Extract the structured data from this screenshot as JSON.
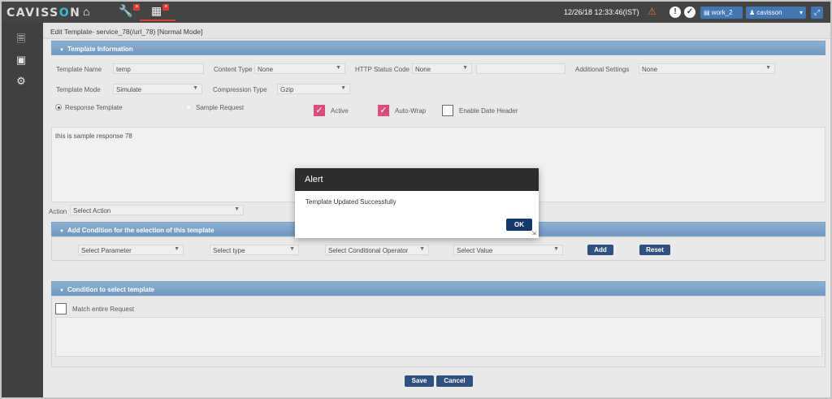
{
  "app": {
    "logo_main": "CAVISS",
    "logo_o": "O",
    "logo_end": "N",
    "datetime": "12/26/18 12:33:46(IST)",
    "workspace_btn": "work_2",
    "user_btn": "cavisson"
  },
  "page": {
    "title": "Edit Template- service_78(/url_78) [Normal Mode]"
  },
  "template_info": {
    "section_title": "Template Information",
    "template_name_label": "Template Name",
    "template_name_value": "temp",
    "content_type_label": "Content Type",
    "content_type_value": "None",
    "http_status_label": "HTTP Status Code",
    "http_status_value": "None",
    "additional_settings_label": "Additional Settings",
    "additional_settings_value": "None",
    "template_mode_label": "Template Mode",
    "template_mode_value": "Simulate",
    "compression_type_label": "Compression Type",
    "compression_type_value": "Gzip",
    "response_template_label": "Response Template",
    "sample_request_label": "Sample Request",
    "active_label": "Active",
    "autowrap_label": "Auto-Wrap",
    "enable_date_header_label": "Enable Date Header",
    "body_text": "this is sample response 78"
  },
  "action": {
    "label": "Action",
    "value": "Select Action"
  },
  "condition_selection": {
    "section_title": "Add Condition for the selection of this template",
    "parameter": "Select Parameter",
    "type": "Select type",
    "operator": "Select Conditional Operator",
    "value": "Select Value",
    "add_label": "Add",
    "reset_label": "Reset"
  },
  "condition_template": {
    "section_title": "Condition to select template",
    "match_label": "Match entire Request"
  },
  "footer": {
    "save_label": "Save",
    "cancel_label": "Cancel"
  },
  "alert": {
    "title": "Alert",
    "message": "Template Updated Successfully",
    "ok_label": "OK"
  },
  "colors": {
    "accent": "#14386e",
    "section_bar": "#5d89b8",
    "checkbox_on": "#d8336b",
    "logo_o": "#1fb5c8"
  }
}
